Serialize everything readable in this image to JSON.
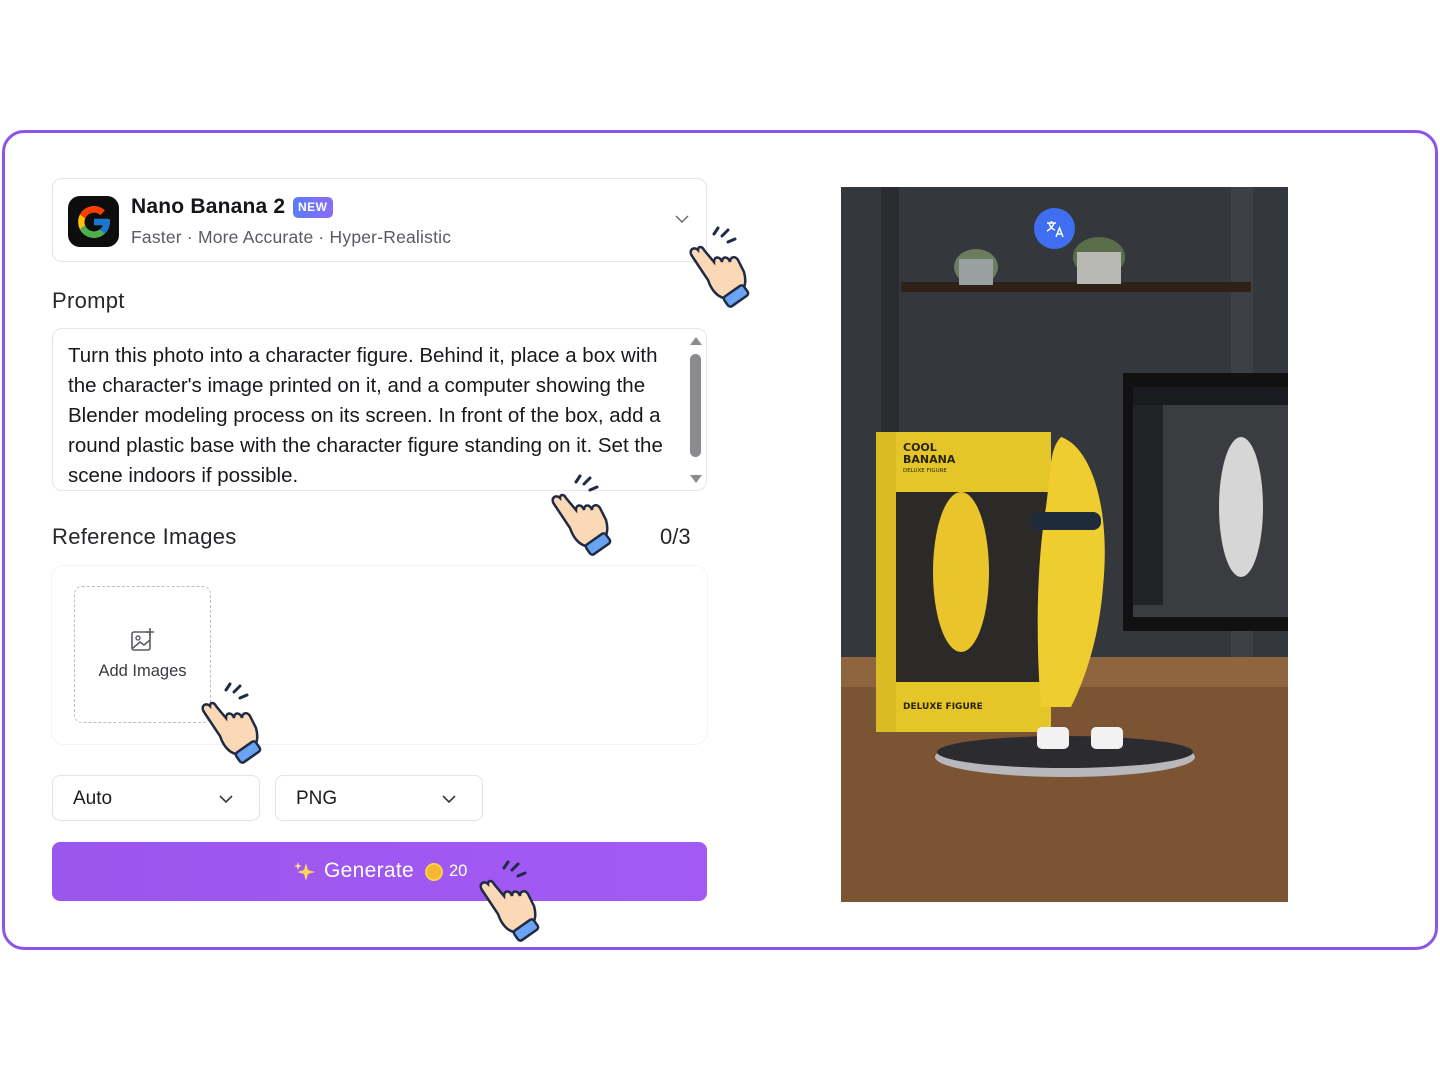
{
  "model": {
    "name": "Nano Banana 2",
    "badge": "NEW",
    "subtitle": "Faster · More Accurate · Hyper-Realistic",
    "logo_icon": "google-g-icon"
  },
  "prompt": {
    "label": "Prompt",
    "text": "Turn this photo into a character figure. Behind it, place a box with the character's image printed on it, and a computer showing the Blender modeling process on its screen. In front of the box, add a round plastic base with the character figure standing on it. Set the scene indoors if possible."
  },
  "reference": {
    "label": "Reference Images",
    "count": "0/3",
    "add_label": "Add Images"
  },
  "options": {
    "ratio": "Auto",
    "format": "PNG"
  },
  "generate": {
    "label": "Generate",
    "cost": "20"
  },
  "preview": {
    "box_title_1": "COOL",
    "box_title_2": "BANANA",
    "box_subtitle": "DELUXE FIGURE",
    "box_footer": "DELUXE FIGURE"
  },
  "colors": {
    "accent": "#8b55e8",
    "button": "#a25af4",
    "translate": "#3f6ff0"
  }
}
